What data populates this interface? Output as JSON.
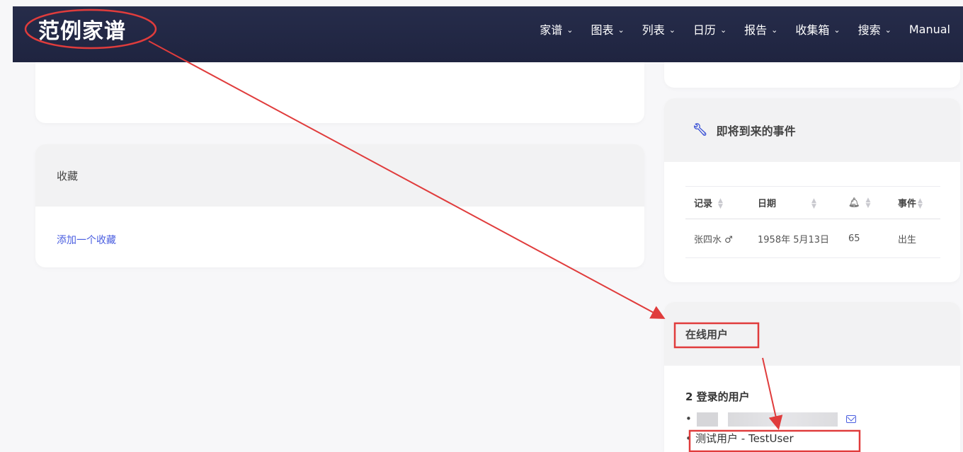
{
  "header": {
    "brand": "范例家谱",
    "menu": [
      {
        "label": "家谱"
      },
      {
        "label": "图表"
      },
      {
        "label": "列表"
      },
      {
        "label": "日历"
      },
      {
        "label": "报告"
      },
      {
        "label": "收集箱"
      },
      {
        "label": "搜索"
      },
      {
        "label": "Manual"
      }
    ]
  },
  "favorites": {
    "title": "收藏",
    "add_link": "添加一个收藏"
  },
  "upcoming": {
    "title": "即将到来的事件",
    "icon": "wrench-icon",
    "columns": [
      "记录",
      "日期",
      "",
      "事件"
    ],
    "rows": [
      {
        "record": "张四水 ♂",
        "date": "1958年 5月13日",
        "years": "65",
        "event": "出生"
      }
    ]
  },
  "online": {
    "title": "在线用户",
    "count_label": "2 登录的用户",
    "users": [
      {
        "name": "测试用户 - TestUser"
      }
    ]
  },
  "annotation": {
    "color": "#e03c3c"
  }
}
